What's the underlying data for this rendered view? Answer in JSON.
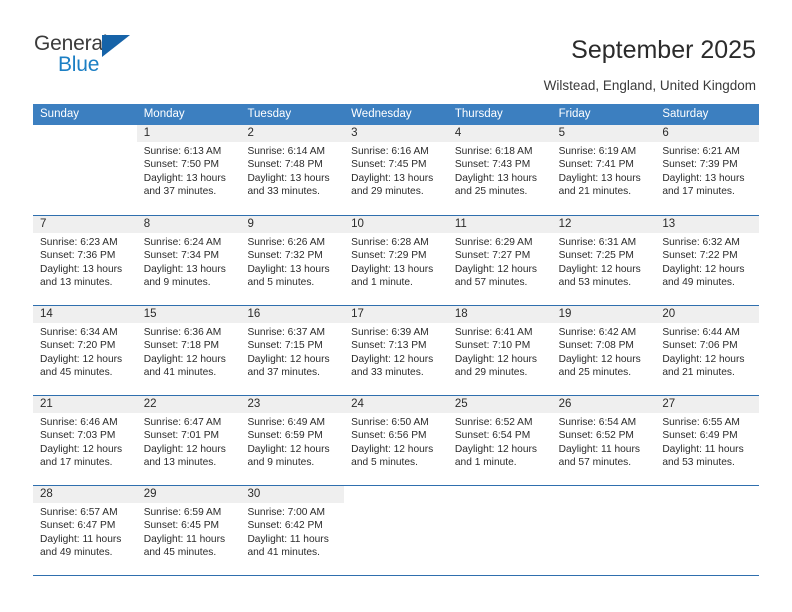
{
  "brand": {
    "name_top": "General",
    "name_bottom": "Blue",
    "accent_color": "#1663a8",
    "text_color": "#3b3b3b"
  },
  "header": {
    "title": "September 2025",
    "location": "Wilstead, England, United Kingdom"
  },
  "calendar": {
    "header_bg": "#3c7fc0",
    "header_text_color": "#ffffff",
    "daynum_band_bg": "#efefef",
    "week_divider_color": "#2f6fae",
    "weekday_headers": [
      "Sunday",
      "Monday",
      "Tuesday",
      "Wednesday",
      "Thursday",
      "Friday",
      "Saturday"
    ],
    "weeks": [
      [
        {
          "day": "",
          "lines": []
        },
        {
          "day": "1",
          "lines": [
            "Sunrise: 6:13 AM",
            "Sunset: 7:50 PM",
            "Daylight: 13 hours",
            "and 37 minutes."
          ]
        },
        {
          "day": "2",
          "lines": [
            "Sunrise: 6:14 AM",
            "Sunset: 7:48 PM",
            "Daylight: 13 hours",
            "and 33 minutes."
          ]
        },
        {
          "day": "3",
          "lines": [
            "Sunrise: 6:16 AM",
            "Sunset: 7:45 PM",
            "Daylight: 13 hours",
            "and 29 minutes."
          ]
        },
        {
          "day": "4",
          "lines": [
            "Sunrise: 6:18 AM",
            "Sunset: 7:43 PM",
            "Daylight: 13 hours",
            "and 25 minutes."
          ]
        },
        {
          "day": "5",
          "lines": [
            "Sunrise: 6:19 AM",
            "Sunset: 7:41 PM",
            "Daylight: 13 hours",
            "and 21 minutes."
          ]
        },
        {
          "day": "6",
          "lines": [
            "Sunrise: 6:21 AM",
            "Sunset: 7:39 PM",
            "Daylight: 13 hours",
            "and 17 minutes."
          ]
        }
      ],
      [
        {
          "day": "7",
          "lines": [
            "Sunrise: 6:23 AM",
            "Sunset: 7:36 PM",
            "Daylight: 13 hours",
            "and 13 minutes."
          ]
        },
        {
          "day": "8",
          "lines": [
            "Sunrise: 6:24 AM",
            "Sunset: 7:34 PM",
            "Daylight: 13 hours",
            "and 9 minutes."
          ]
        },
        {
          "day": "9",
          "lines": [
            "Sunrise: 6:26 AM",
            "Sunset: 7:32 PM",
            "Daylight: 13 hours",
            "and 5 minutes."
          ]
        },
        {
          "day": "10",
          "lines": [
            "Sunrise: 6:28 AM",
            "Sunset: 7:29 PM",
            "Daylight: 13 hours",
            "and 1 minute."
          ]
        },
        {
          "day": "11",
          "lines": [
            "Sunrise: 6:29 AM",
            "Sunset: 7:27 PM",
            "Daylight: 12 hours",
            "and 57 minutes."
          ]
        },
        {
          "day": "12",
          "lines": [
            "Sunrise: 6:31 AM",
            "Sunset: 7:25 PM",
            "Daylight: 12 hours",
            "and 53 minutes."
          ]
        },
        {
          "day": "13",
          "lines": [
            "Sunrise: 6:32 AM",
            "Sunset: 7:22 PM",
            "Daylight: 12 hours",
            "and 49 minutes."
          ]
        }
      ],
      [
        {
          "day": "14",
          "lines": [
            "Sunrise: 6:34 AM",
            "Sunset: 7:20 PM",
            "Daylight: 12 hours",
            "and 45 minutes."
          ]
        },
        {
          "day": "15",
          "lines": [
            "Sunrise: 6:36 AM",
            "Sunset: 7:18 PM",
            "Daylight: 12 hours",
            "and 41 minutes."
          ]
        },
        {
          "day": "16",
          "lines": [
            "Sunrise: 6:37 AM",
            "Sunset: 7:15 PM",
            "Daylight: 12 hours",
            "and 37 minutes."
          ]
        },
        {
          "day": "17",
          "lines": [
            "Sunrise: 6:39 AM",
            "Sunset: 7:13 PM",
            "Daylight: 12 hours",
            "and 33 minutes."
          ]
        },
        {
          "day": "18",
          "lines": [
            "Sunrise: 6:41 AM",
            "Sunset: 7:10 PM",
            "Daylight: 12 hours",
            "and 29 minutes."
          ]
        },
        {
          "day": "19",
          "lines": [
            "Sunrise: 6:42 AM",
            "Sunset: 7:08 PM",
            "Daylight: 12 hours",
            "and 25 minutes."
          ]
        },
        {
          "day": "20",
          "lines": [
            "Sunrise: 6:44 AM",
            "Sunset: 7:06 PM",
            "Daylight: 12 hours",
            "and 21 minutes."
          ]
        }
      ],
      [
        {
          "day": "21",
          "lines": [
            "Sunrise: 6:46 AM",
            "Sunset: 7:03 PM",
            "Daylight: 12 hours",
            "and 17 minutes."
          ]
        },
        {
          "day": "22",
          "lines": [
            "Sunrise: 6:47 AM",
            "Sunset: 7:01 PM",
            "Daylight: 12 hours",
            "and 13 minutes."
          ]
        },
        {
          "day": "23",
          "lines": [
            "Sunrise: 6:49 AM",
            "Sunset: 6:59 PM",
            "Daylight: 12 hours",
            "and 9 minutes."
          ]
        },
        {
          "day": "24",
          "lines": [
            "Sunrise: 6:50 AM",
            "Sunset: 6:56 PM",
            "Daylight: 12 hours",
            "and 5 minutes."
          ]
        },
        {
          "day": "25",
          "lines": [
            "Sunrise: 6:52 AM",
            "Sunset: 6:54 PM",
            "Daylight: 12 hours",
            "and 1 minute."
          ]
        },
        {
          "day": "26",
          "lines": [
            "Sunrise: 6:54 AM",
            "Sunset: 6:52 PM",
            "Daylight: 11 hours",
            "and 57 minutes."
          ]
        },
        {
          "day": "27",
          "lines": [
            "Sunrise: 6:55 AM",
            "Sunset: 6:49 PM",
            "Daylight: 11 hours",
            "and 53 minutes."
          ]
        }
      ],
      [
        {
          "day": "28",
          "lines": [
            "Sunrise: 6:57 AM",
            "Sunset: 6:47 PM",
            "Daylight: 11 hours",
            "and 49 minutes."
          ]
        },
        {
          "day": "29",
          "lines": [
            "Sunrise: 6:59 AM",
            "Sunset: 6:45 PM",
            "Daylight: 11 hours",
            "and 45 minutes."
          ]
        },
        {
          "day": "30",
          "lines": [
            "Sunrise: 7:00 AM",
            "Sunset: 6:42 PM",
            "Daylight: 11 hours",
            "and 41 minutes."
          ]
        },
        {
          "day": "",
          "lines": []
        },
        {
          "day": "",
          "lines": []
        },
        {
          "day": "",
          "lines": []
        },
        {
          "day": "",
          "lines": []
        }
      ]
    ]
  }
}
